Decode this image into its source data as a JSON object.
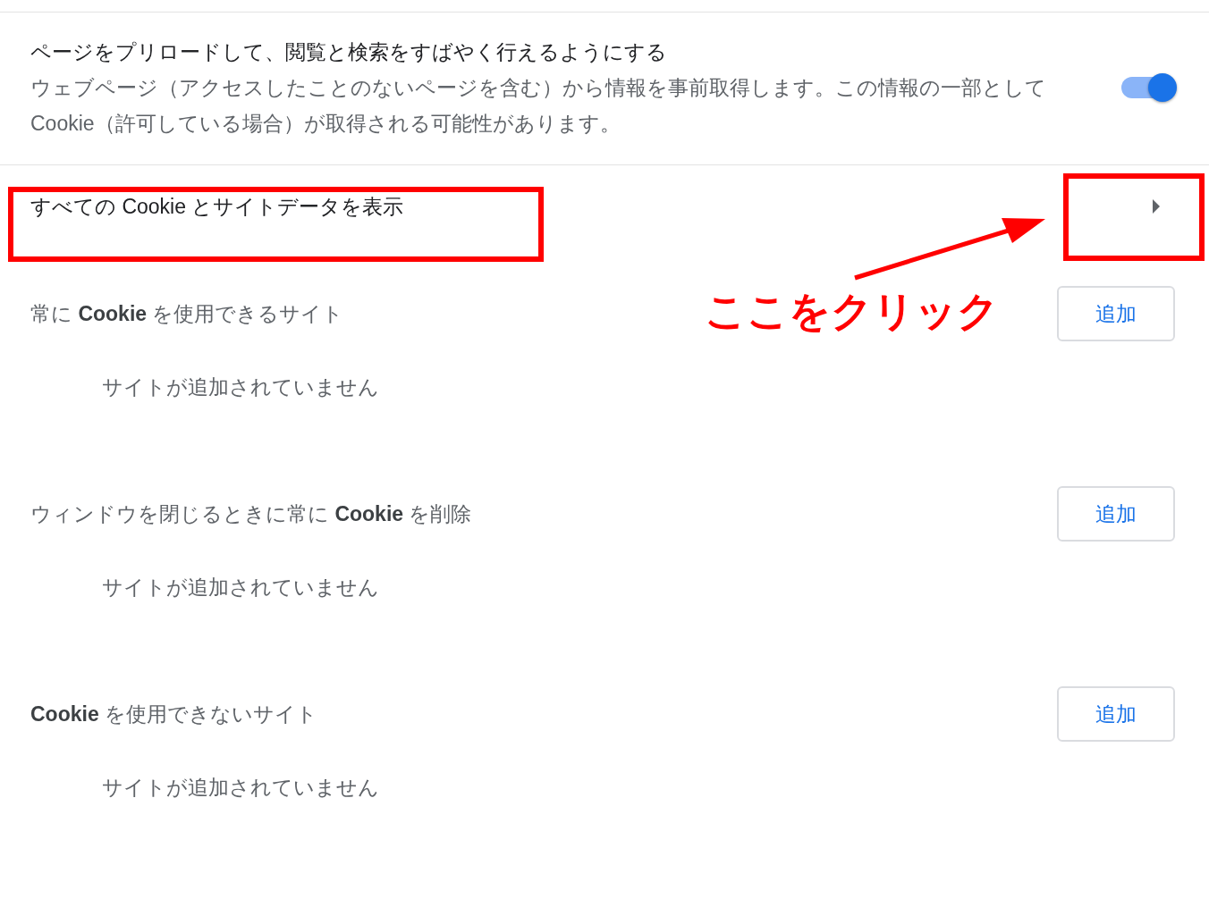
{
  "preload": {
    "title": "ページをプリロードして、閲覧と検索をすばやく行えるようにする",
    "description": "ウェブページ（アクセスしたことのないページを含む）から情報を事前取得します。この情報の一部として Cookie（許可している場合）が取得される可能性があります。",
    "on": true
  },
  "all_cookies_link": {
    "label": "すべての Cookie とサイトデータを表示"
  },
  "annotation": {
    "label": "ここをクリック"
  },
  "sections": [
    {
      "title": "常に **Cookie** を使用できるサイト",
      "button": "追加",
      "empty_message": "サイトが追加されていません"
    },
    {
      "title": "ウィンドウを閉じるときに常に **Cookie** を削除",
      "button": "追加",
      "empty_message": "サイトが追加されていません"
    },
    {
      "title": "**Cookie** を使用できないサイト",
      "button": "追加",
      "empty_message": "サイトが追加されていません"
    }
  ]
}
